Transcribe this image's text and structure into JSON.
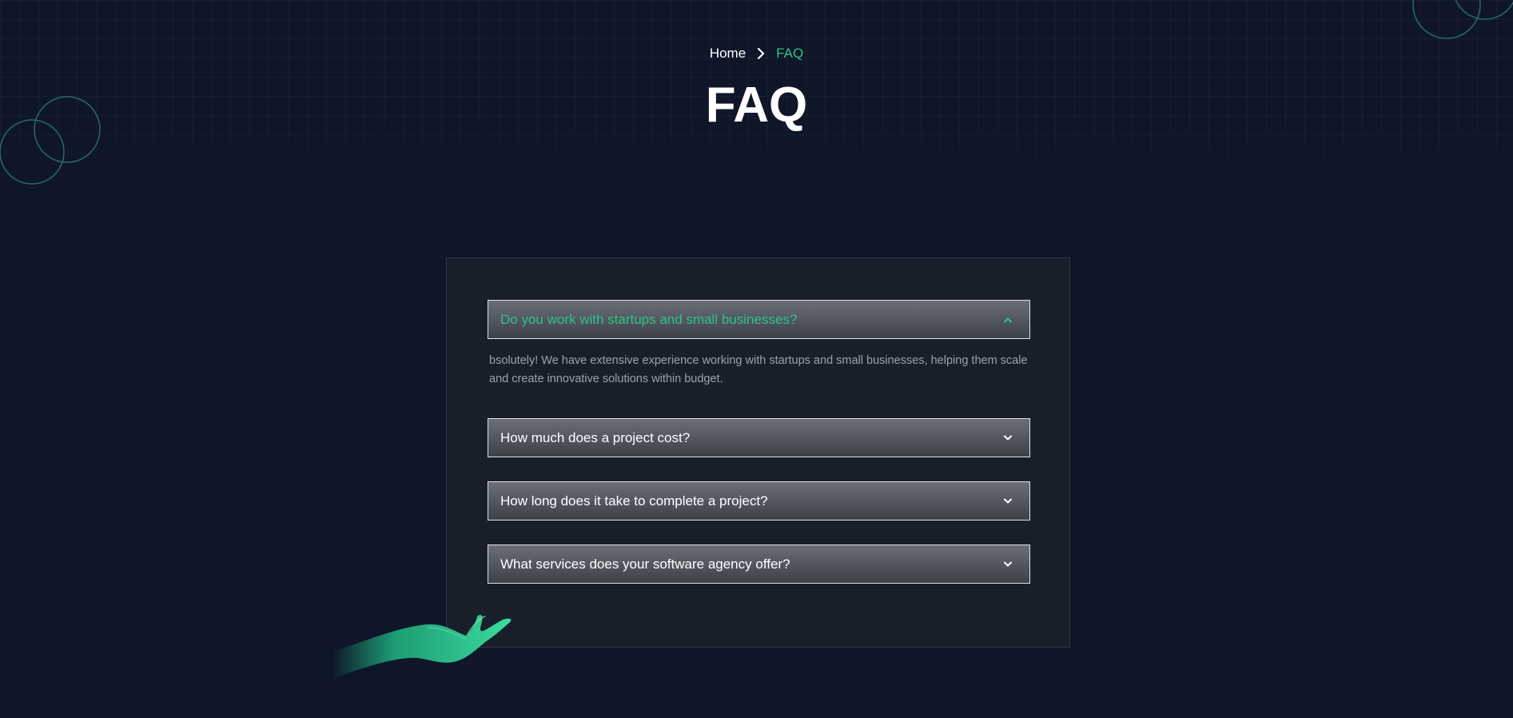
{
  "breadcrumb": {
    "home": "Home",
    "current": "FAQ",
    "separator_icon": "chevron-right-icon"
  },
  "page": {
    "title": "FAQ"
  },
  "faq": {
    "items": [
      {
        "question": "Do you work with startups and small businesses?",
        "answer": "bsolutely! We have extensive experience working with startups and small businesses, helping them scale and create innovative solutions within budget.",
        "expanded": true,
        "icon": "chevron-up-icon"
      },
      {
        "question": "How much does a project cost?",
        "expanded": false,
        "icon": "chevron-down-icon"
      },
      {
        "question": "How long does it take to complete a project?",
        "expanded": false,
        "icon": "chevron-down-icon"
      },
      {
        "question": "What services does your software agency offer?",
        "expanded": false,
        "icon": "chevron-down-icon"
      }
    ]
  },
  "colors": {
    "background": "#0e1628",
    "panel": "#181f2a",
    "accent": "#2ec389",
    "text": "#ffffff",
    "muted_text": "#9aa3b1"
  }
}
